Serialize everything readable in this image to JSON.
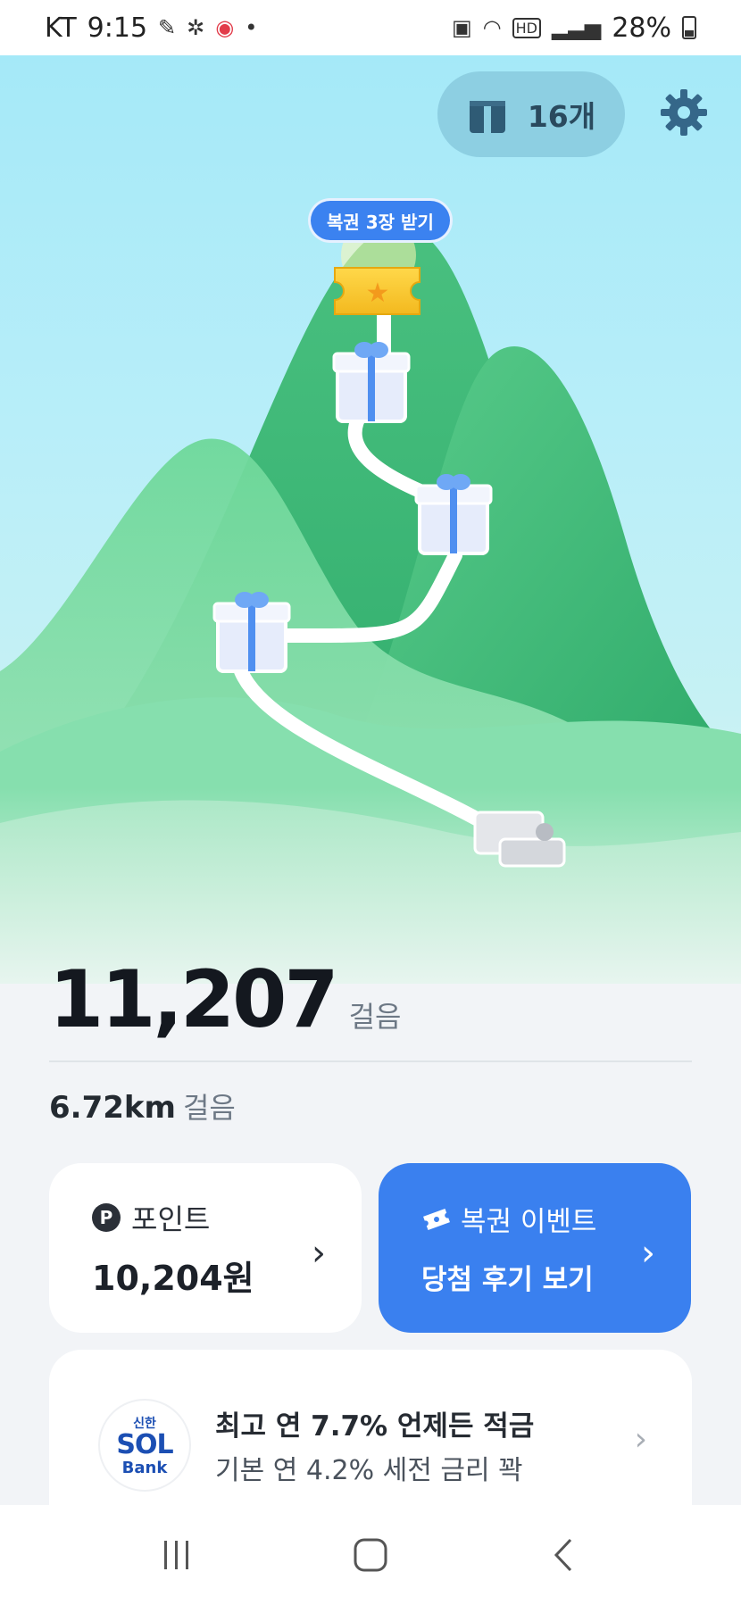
{
  "status_bar": {
    "carrier": "KT",
    "time": "9:15",
    "battery": "28%"
  },
  "header": {
    "coupon_count": "16개",
    "coupon_icon": "gift-box-icon",
    "settings_icon": "gear-icon"
  },
  "map": {
    "summit_label": "복권 3장 받기",
    "summit_icon": "lottery-ticket-icon",
    "milestone_icon": "gift-box-icon"
  },
  "steps": {
    "count": "11,207",
    "unit": "걸음",
    "distance": "6.72km",
    "distance_unit": "걸음"
  },
  "points_card": {
    "badge": "P",
    "title": "포인트",
    "value": "10,204원"
  },
  "lottery_card": {
    "title": "복권 이벤트",
    "subtitle": "당첨 후기 보기",
    "icon": "ticket-icon"
  },
  "bank_card": {
    "logo_top": "신한",
    "logo_mid": "SOL",
    "logo_bottom": "Bank",
    "title": "최고 연 7.7% 언제든 적금",
    "subtitle": "기본 연 4.2% 세전 금리 꽉"
  },
  "nav": {
    "recent_icon": "recent-apps-icon",
    "home_icon": "home-icon",
    "back_icon": "back-icon"
  },
  "colors": {
    "accent": "#3a80ef",
    "mountain_dark": "#2aa868",
    "mountain_light": "#7ddca5",
    "sky": "#a5e9f8"
  }
}
